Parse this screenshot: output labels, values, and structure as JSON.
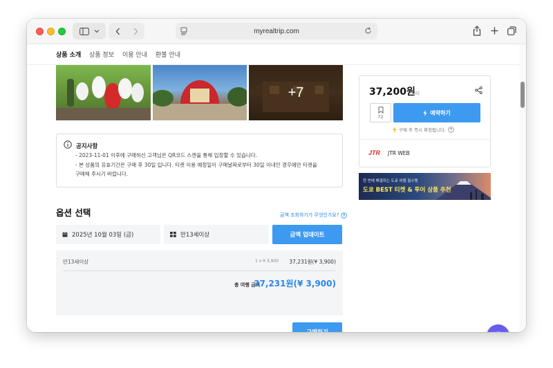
{
  "browser": {
    "url": "myrealtrip.com"
  },
  "tabs": [
    {
      "label": "상품 소개",
      "active": true
    },
    {
      "label": "상품 정보",
      "active": false
    },
    {
      "label": "이용 안내",
      "active": false
    },
    {
      "label": "환불 안내",
      "active": false
    }
  ],
  "gallery": {
    "more_label": "+7"
  },
  "notice": {
    "title": "공지사항",
    "line1": "- 2023-11-01 이후에 구매하신 고객님은 QR코드 스캔을 통해 입장할 수 있습니다.",
    "line2": "- 본 상품의 유효기간은 구매 후 30일 입니다. 티켓 이용 예정일이 구매날짜로부터 30일 이내인 경우에만 티켓을",
    "line3": "구매해 주시기 바랍니다."
  },
  "options": {
    "title": "옵션 선택",
    "help_link": "금액 조회하기가 무엇인가요?",
    "date_value": "2025년 10월 03일 (금)",
    "age_value": "만13세이상",
    "update_label": "금액 업데이트",
    "item_label": "만13세이상",
    "item_unit": "1 x ¥ 3,900",
    "item_price": "37,231원(¥ 3,900)",
    "total_label": "총 여행 금액",
    "total_value": "37,231원(¥ 3,900)",
    "buy_label": "구매하기"
  },
  "card": {
    "price": "37,200원",
    "price_suffix": "부터",
    "wish_count": "72",
    "reserve_label": "예약하기",
    "instant_text": "구매 후 즉시 확정됩니다.",
    "seller_logo": "JTR",
    "seller_name": "JTR WEB"
  },
  "banner": {
    "subtitle": "한 번에 해결하는 도쿄 여행 필수템",
    "title": "도쿄 BEST 티켓 & 투어 상품 추천"
  },
  "colors": {
    "accent": "#3d9af0",
    "link": "#2b86e8",
    "chat": "#6a5cf0"
  }
}
